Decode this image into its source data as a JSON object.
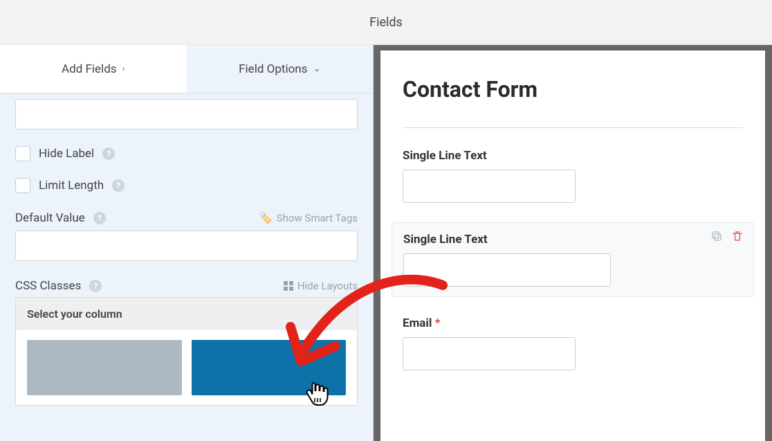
{
  "header": {
    "title": "Fields"
  },
  "tabs": {
    "add": "Add Fields",
    "options": "Field Options"
  },
  "options": {
    "hide_label": "Hide Label",
    "limit_length": "Limit Length",
    "default_value_label": "Default Value",
    "smart_tags": "Show Smart Tags",
    "css_classes_label": "CSS Classes",
    "hide_layouts": "Hide Layouts",
    "picker_title": "Select your column"
  },
  "form": {
    "title": "Contact Form",
    "fields": [
      {
        "label": "Single Line Text",
        "required": false
      },
      {
        "label": "Single Line Text",
        "required": false,
        "selected": true
      },
      {
        "label": "Email",
        "required": true
      }
    ]
  }
}
